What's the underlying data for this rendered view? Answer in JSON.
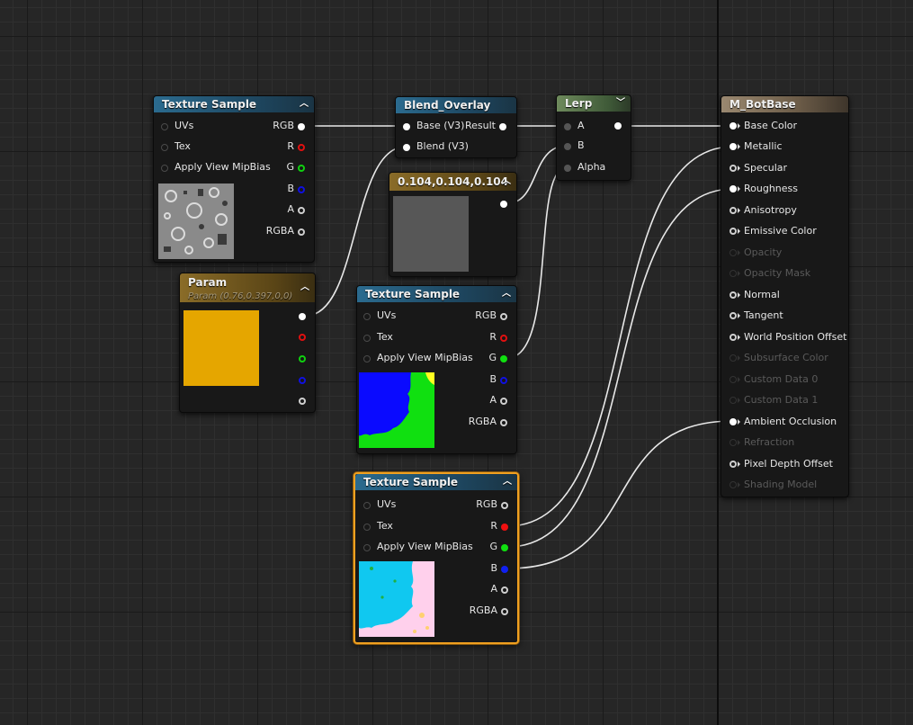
{
  "colors": {
    "red": "#e01010",
    "green": "#10d010",
    "blue": "#1010e0",
    "white": "#ffffff",
    "param_swatch": "#e5a600",
    "constant_swatch": "#575757"
  },
  "node_tex1": {
    "title": "Texture Sample",
    "inputs": [
      "UVs",
      "Tex",
      "Apply View MipBias"
    ],
    "outputs": [
      "RGB",
      "R",
      "G",
      "B",
      "A",
      "RGBA"
    ]
  },
  "node_blend": {
    "title": "Blend_Overlay",
    "inputs": [
      "Base (V3)",
      "Blend (V3)"
    ],
    "output": "Result"
  },
  "node_lerp": {
    "title": "Lerp",
    "inputs": [
      "A",
      "B",
      "Alpha"
    ]
  },
  "node_const": {
    "title": "0.104,0.104,0.104"
  },
  "node_param": {
    "title": "Param",
    "subtitle": "Param (0.76,0.397,0,0)"
  },
  "node_tex2": {
    "title": "Texture Sample",
    "inputs": [
      "UVs",
      "Tex",
      "Apply View MipBias"
    ],
    "outputs": [
      "RGB",
      "R",
      "G",
      "B",
      "A",
      "RGBA"
    ]
  },
  "node_tex3": {
    "title": "Texture Sample",
    "inputs": [
      "UVs",
      "Tex",
      "Apply View MipBias"
    ],
    "outputs": [
      "RGB",
      "R",
      "G",
      "B",
      "A",
      "RGBA"
    ]
  },
  "material": {
    "title": "M_BotBase",
    "inputs": [
      {
        "label": "Base Color",
        "state": "connected"
      },
      {
        "label": "Metallic",
        "state": "connected"
      },
      {
        "label": "Specular",
        "state": "open"
      },
      {
        "label": "Roughness",
        "state": "connected"
      },
      {
        "label": "Anisotropy",
        "state": "open"
      },
      {
        "label": "Emissive Color",
        "state": "open"
      },
      {
        "label": "Opacity",
        "state": "disabled"
      },
      {
        "label": "Opacity Mask",
        "state": "disabled"
      },
      {
        "label": "Normal",
        "state": "open"
      },
      {
        "label": "Tangent",
        "state": "open"
      },
      {
        "label": "World Position Offset",
        "state": "open"
      },
      {
        "label": "Subsurface Color",
        "state": "disabled"
      },
      {
        "label": "Custom Data 0",
        "state": "disabled"
      },
      {
        "label": "Custom Data 1",
        "state": "disabled"
      },
      {
        "label": "Ambient Occlusion",
        "state": "connected"
      },
      {
        "label": "Refraction",
        "state": "disabled"
      },
      {
        "label": "Pixel Depth Offset",
        "state": "open"
      },
      {
        "label": "Shading Model",
        "state": "disabled"
      }
    ]
  }
}
